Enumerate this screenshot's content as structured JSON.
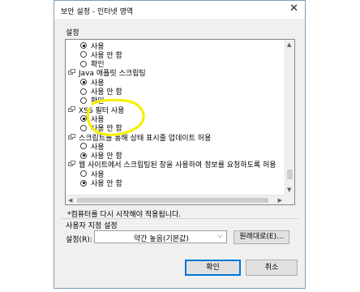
{
  "dialog": {
    "title": "보안 설정 - 인터넷 영역",
    "close_glyph": "✕"
  },
  "settings_group": {
    "label": "설정",
    "items": [
      {
        "type": "radio",
        "label": "사용",
        "selected": true
      },
      {
        "type": "radio",
        "label": "사용 안 함",
        "selected": false
      },
      {
        "type": "radio",
        "label": "확인",
        "selected": false
      },
      {
        "type": "header",
        "label": "Java 애플릿 스크립팅"
      },
      {
        "type": "radio",
        "label": "사용",
        "selected": true
      },
      {
        "type": "radio",
        "label": "사용 안 함",
        "selected": false
      },
      {
        "type": "radio",
        "label": "확인",
        "selected": false
      },
      {
        "type": "header",
        "label": "XSS 필터 사용"
      },
      {
        "type": "radio",
        "label": "사용",
        "selected": true
      },
      {
        "type": "radio",
        "label": "사용 안 함",
        "selected": false
      },
      {
        "type": "header",
        "label": "스크립트를 통해 상태 표시줄 업데이트 허용"
      },
      {
        "type": "radio",
        "label": "사용",
        "selected": false
      },
      {
        "type": "radio",
        "label": "사용 안 함",
        "selected": true
      },
      {
        "type": "header",
        "label": "웹 사이트에서 스크립팅된 창을 사용하여 정보를 요청하도록 허용"
      },
      {
        "type": "radio",
        "label": "사용",
        "selected": false
      },
      {
        "type": "radio",
        "label": "사용 안 함",
        "selected": true
      }
    ],
    "note": "*컴퓨터를 다시 시작해야 적용됩니다."
  },
  "custom_group": {
    "label": "사용자 지정 설정",
    "field_label": "설정(R):",
    "selected_value": "약간 높음(기본값)",
    "reset_button": "원래대로(E)..."
  },
  "buttons": {
    "ok": "확인",
    "cancel": "취소"
  },
  "annotation_color": "#f7ef00"
}
